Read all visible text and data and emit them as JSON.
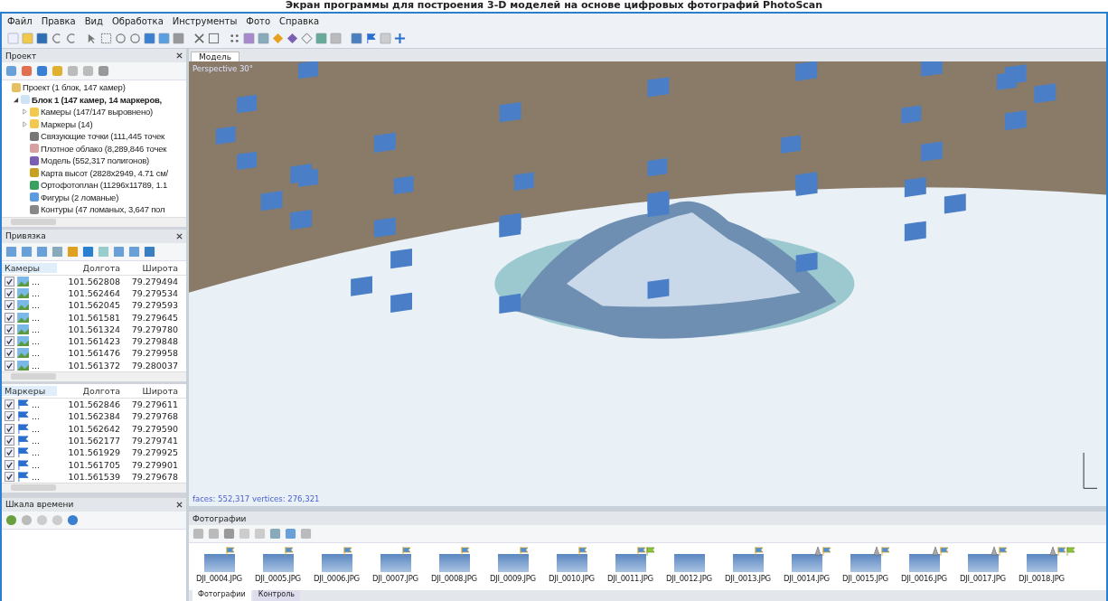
{
  "caption": "Экран программы для построения 3-D моделей на основе цифровых фотографий PhotoScan",
  "menu": [
    "Файл",
    "Правка",
    "Вид",
    "Обработка",
    "Инструменты",
    "Фото",
    "Справка"
  ],
  "project": {
    "title": "Проект",
    "items": [
      {
        "kind": "project",
        "text": "Проект (1 блок, 147 камер)",
        "children": [
          {
            "kind": "block",
            "text": "Блок 1 (147 камер, 14 маркеров,",
            "expanded": true,
            "children": [
              {
                "kind": "folder",
                "text": "Камеры (147/147 выровнено)",
                "expanded": false
              },
              {
                "kind": "folder",
                "text": "Маркеры (14)",
                "expanded": false
              },
              {
                "kind": "points",
                "text": "Связующие точки (111,445 точек"
              },
              {
                "kind": "cloud",
                "text": "Плотное облако (8,289,846 точек"
              },
              {
                "kind": "model",
                "text": "Модель (552,317 полигонов)"
              },
              {
                "kind": "dem",
                "text": "Карта высот (2828x2949, 4.71 см/"
              },
              {
                "kind": "ortho",
                "text": "Ортофотоплан (11296x11789, 1.1"
              },
              {
                "kind": "shape",
                "text": "Фигуры (2 ломаные)"
              },
              {
                "kind": "contour",
                "text": "Контуры (47 ломаных, 3,647 пол"
              }
            ]
          }
        ]
      }
    ]
  },
  "reference": {
    "title": "Привязка",
    "cameras": {
      "columns": [
        "Камеры",
        "Долгота",
        "Широта"
      ],
      "rows": [
        {
          "checked": true,
          "name": "...",
          "lon": "101.562808",
          "lat": "79.279494"
        },
        {
          "checked": true,
          "name": "...",
          "lon": "101.562464",
          "lat": "79.279534"
        },
        {
          "checked": true,
          "name": "...",
          "lon": "101.562045",
          "lat": "79.279593"
        },
        {
          "checked": true,
          "name": "...",
          "lon": "101.561581",
          "lat": "79.279645"
        },
        {
          "checked": true,
          "name": "...",
          "lon": "101.561324",
          "lat": "79.279780"
        },
        {
          "checked": true,
          "name": "...",
          "lon": "101.561423",
          "lat": "79.279848"
        },
        {
          "checked": true,
          "name": "...",
          "lon": "101.561476",
          "lat": "79.279958"
        },
        {
          "checked": true,
          "name": "...",
          "lon": "101.561372",
          "lat": "79.280037"
        }
      ]
    },
    "markers": {
      "columns": [
        "Маркеры",
        "Долгота",
        "Широта"
      ],
      "rows": [
        {
          "checked": true,
          "name": "...",
          "lon": "101.562846",
          "lat": "79.279611"
        },
        {
          "checked": true,
          "name": "...",
          "lon": "101.562384",
          "lat": "79.279768"
        },
        {
          "checked": true,
          "name": "...",
          "lon": "101.562642",
          "lat": "79.279590"
        },
        {
          "checked": true,
          "name": "...",
          "lon": "101.562177",
          "lat": "79.279741"
        },
        {
          "checked": true,
          "name": "...",
          "lon": "101.561929",
          "lat": "79.279925"
        },
        {
          "checked": true,
          "name": "...",
          "lon": "101.561705",
          "lat": "79.279901"
        },
        {
          "checked": true,
          "name": "...",
          "lon": "101.561539",
          "lat": "79.279678"
        }
      ]
    }
  },
  "timeline": {
    "title": "Шкала времени"
  },
  "model": {
    "tab": "Модель",
    "projection": "Perspective 30°",
    "stats": "faces: 552,317 vertices: 276,321"
  },
  "photos": {
    "title": "Фотографии",
    "items": [
      {
        "name": "DJI_0004.JPG",
        "has_cone": false,
        "has_marker": true,
        "has_green_marker": false
      },
      {
        "name": "DJI_0005.JPG",
        "has_cone": false,
        "has_marker": true,
        "has_green_marker": false
      },
      {
        "name": "DJI_0006.JPG",
        "has_cone": false,
        "has_marker": true,
        "has_green_marker": false
      },
      {
        "name": "DJI_0007.JPG",
        "has_cone": false,
        "has_marker": true,
        "has_green_marker": false
      },
      {
        "name": "DJI_0008.JPG",
        "has_cone": false,
        "has_marker": true,
        "has_green_marker": false
      },
      {
        "name": "DJI_0009.JPG",
        "has_cone": false,
        "has_marker": true,
        "has_green_marker": false
      },
      {
        "name": "DJI_0010.JPG",
        "has_cone": false,
        "has_marker": true,
        "has_green_marker": false
      },
      {
        "name": "DJI_0011.JPG",
        "has_cone": false,
        "has_marker": true,
        "has_green_marker": true
      },
      {
        "name": "DJI_0012.JPG",
        "has_cone": false,
        "has_marker": false,
        "has_green_marker": false
      },
      {
        "name": "DJI_0013.JPG",
        "has_cone": false,
        "has_marker": true,
        "has_green_marker": false
      },
      {
        "name": "DJI_0014.JPG",
        "has_cone": true,
        "has_marker": true,
        "has_green_marker": false
      },
      {
        "name": "DJI_0015.JPG",
        "has_cone": true,
        "has_marker": true,
        "has_green_marker": false
      },
      {
        "name": "DJI_0016.JPG",
        "has_cone": true,
        "has_marker": true,
        "has_green_marker": false
      },
      {
        "name": "DJI_0017.JPG",
        "has_cone": true,
        "has_marker": true,
        "has_green_marker": false
      },
      {
        "name": "DJI_0018.JPG",
        "has_cone": true,
        "has_marker": true,
        "has_green_marker": true
      }
    ],
    "tabs": [
      {
        "label": "Фотографии",
        "selected": true
      },
      {
        "label": "Контроль",
        "selected": false
      }
    ]
  }
}
